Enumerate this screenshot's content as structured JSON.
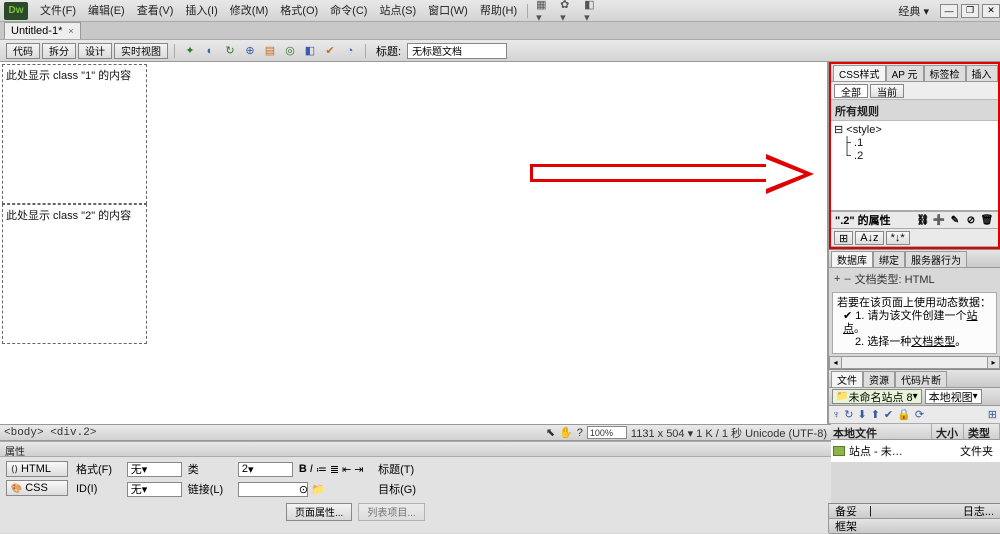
{
  "app": {
    "logo_text": "Dw"
  },
  "menu": {
    "file": "文件(F)",
    "edit": "编辑(E)",
    "view": "查看(V)",
    "insert": "插入(I)",
    "modify": "修改(M)",
    "format": "格式(O)",
    "commands": "命令(C)",
    "site": "站点(S)",
    "window": "窗口(W)",
    "help": "帮助(H)"
  },
  "top_right": {
    "layout": "经典"
  },
  "window_btns": {
    "min": "—",
    "restore": "❐",
    "close": "✕"
  },
  "doc": {
    "tab_label": "Untitled-1*",
    "close": "×"
  },
  "view_tabs": {
    "code": "代码",
    "split": "拆分",
    "design": "设计",
    "live": "实时视图"
  },
  "title_bar": {
    "label": "标题:",
    "value": "无标题文档"
  },
  "canvas": {
    "box1_text": "此处显示 class \"1\" 的内容",
    "box2_text": "此处显示 class \"2\" 的内容"
  },
  "css_panel": {
    "tabs": {
      "css": "CSS样式",
      "ap": "AP 元",
      "tags": "标签检",
      "insert": "插入"
    },
    "sub": {
      "all": "全部",
      "current": "当前"
    },
    "rules_label": "所有规则",
    "tree": {
      "root": "<style>",
      "r1": ".1",
      "r2": ".2"
    },
    "propbar_label": "\".2\" 的属性",
    "propbar_icons_left": {
      "az": "A↓z",
      "sort": "*↓*"
    },
    "propbar_icons_right": {
      "link": "⛓",
      "new": "➕",
      "edit": "✎",
      "disable": "⊘",
      "trash": "🗑"
    }
  },
  "db_panel": {
    "tabs": {
      "db": "数据库",
      "bind": "绑定",
      "behave": "服务器行为"
    },
    "doctype_label": "文档类型: HTML",
    "plus": "+",
    "minus": "–",
    "info_heading": "若要在该页面上使用动态数据：",
    "step1_pre": "1. 请为该文件创建一个",
    "step1_link": "站点",
    "step1_post": "。",
    "step2_pre": "2. 选择一种",
    "step2_link": "文档类型",
    "step2_post": "。",
    "check": "✔"
  },
  "file_panel": {
    "tabs": {
      "files": "文件",
      "assets": "资源",
      "snippets": "代码片断"
    },
    "site_sel": "未命名站点 8",
    "view_sel": "本地视图",
    "cols": {
      "c1": "本地文件",
      "c2": "大小",
      "c3": "类型"
    },
    "row1": {
      "name": "站点 - 未…",
      "type": "文件夹"
    }
  },
  "status": {
    "path": "<body> <div.2>",
    "tools": {
      "pointer": "⬉",
      "hand": "✋",
      "qmark": "?"
    },
    "zoom": "100%",
    "info": "1131 x 504 ▾  1 K / 1 秒 Unicode (UTF-8)"
  },
  "props": {
    "header": "属性",
    "left_html": "HTML",
    "left_css": "CSS",
    "format_label": "格式(F)",
    "format_val": "无",
    "class_label": "类",
    "class_val": "2",
    "id_label": "ID(I)",
    "id_val": "无",
    "link_label": "链接(L)",
    "link_val": "",
    "title2_label": "标题(T)",
    "target_label": "目标(G)",
    "page_props": "页面属性...",
    "list_item": "列表项目...",
    "bold": "B",
    "italic": "I"
  },
  "frame_panel": {
    "tabs": {
      "frames": "框架",
      "sidebar": "备妥",
      "t3": "|",
      "log": "日志..."
    }
  }
}
